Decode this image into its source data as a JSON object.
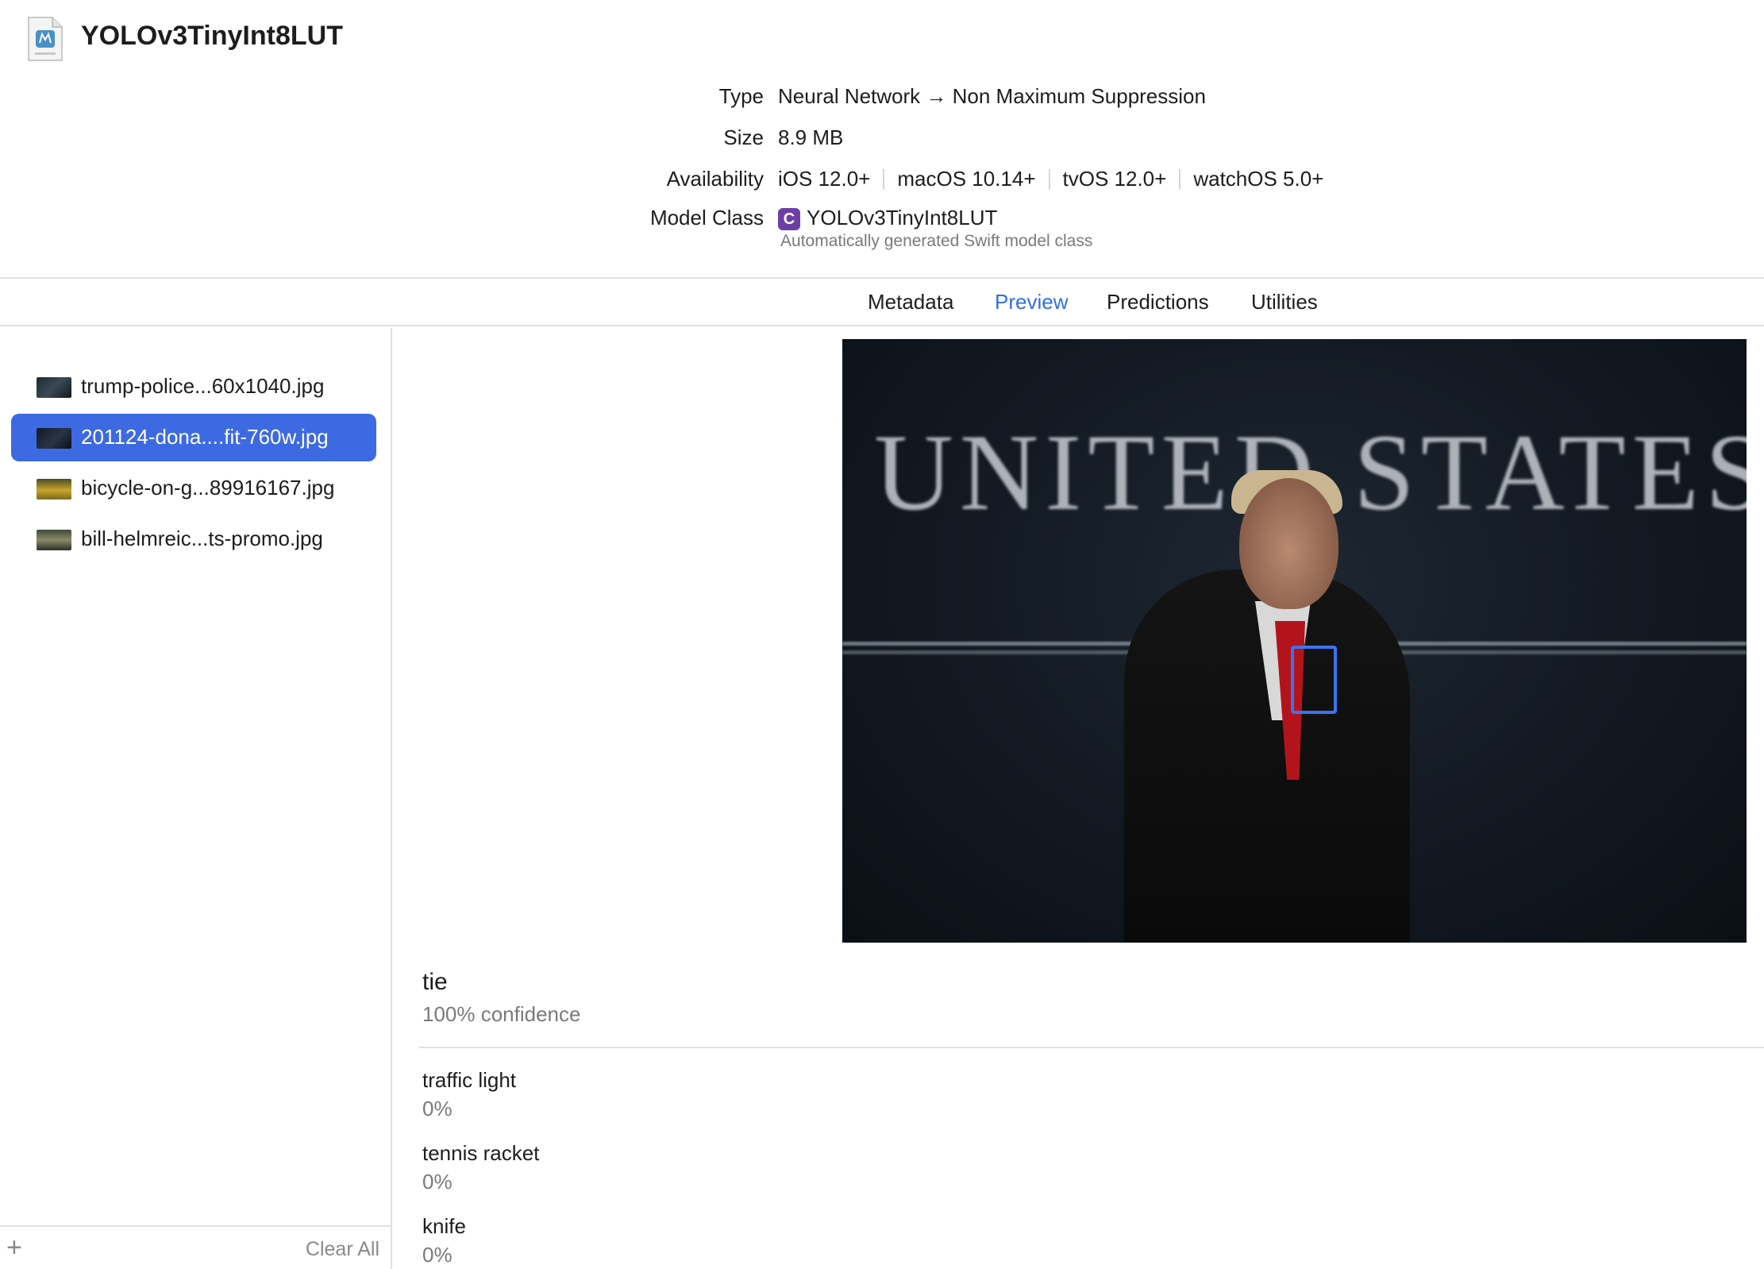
{
  "header": {
    "title": "YOLOv3TinyInt8LUT",
    "icon": "mlmodel-file-icon",
    "type_label": "Type",
    "type_value": "Neural Network → Non Maximum Suppression",
    "size_label": "Size",
    "size_value": "8.9 MB",
    "availability_label": "Availability",
    "availability": [
      "iOS 12.0+",
      "macOS 10.14+",
      "tvOS 12.0+",
      "watchOS 5.0+"
    ],
    "model_class_label": "Model Class",
    "model_class_badge": "C",
    "model_class_value": "YOLOv3TinyInt8LUT",
    "model_class_sub": "Automatically generated Swift model class"
  },
  "tabs": [
    {
      "label": "Metadata",
      "active": false
    },
    {
      "label": "Preview",
      "active": true
    },
    {
      "label": "Predictions",
      "active": false
    },
    {
      "label": "Utilities",
      "active": false
    }
  ],
  "sidebar": {
    "files": [
      {
        "name": "trump-police...60x1040.jpg",
        "selected": false
      },
      {
        "name": "201124-dona....fit-760w.jpg",
        "selected": true
      },
      {
        "name": "bicycle-on-g...89916167.jpg",
        "selected": false
      },
      {
        "name": "bill-helmreic...ts-promo.jpg",
        "selected": false
      }
    ],
    "add_label": "+",
    "clear_label": "Clear All"
  },
  "preview": {
    "image_text": "UNITED STATES",
    "detections": [
      {
        "label": "tie",
        "confidence": 1.0
      }
    ]
  },
  "predictions": {
    "top": {
      "label": "tie",
      "confidence_text": "100% confidence"
    },
    "others": [
      {
        "label": "traffic light",
        "value": "0%"
      },
      {
        "label": "tennis racket",
        "value": "0%"
      },
      {
        "label": "knife",
        "value": "0%"
      }
    ]
  },
  "colors": {
    "accent": "#2f6fe4",
    "selection": "#3d6ae2",
    "bbox": "#3b73ee",
    "class_badge": "#6e3fa3"
  }
}
